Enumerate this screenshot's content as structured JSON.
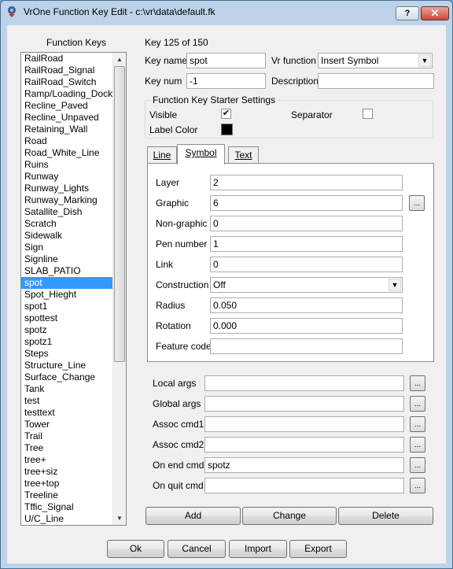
{
  "window": {
    "title": "VrOne Function Key Edit - c:\\vr\\data\\default.fk",
    "help_label": "?",
    "close_label": "✕"
  },
  "left": {
    "header": "Function Keys",
    "items": [
      "RailRoad",
      "RailRoad_Signal",
      "RailRoad_Switch",
      "Ramp/Loading_Dock",
      "Recline_Paved",
      "Recline_Unpaved",
      "Retaining_Wall",
      "Road",
      "Road_White_Line",
      "Ruins",
      "Runway",
      "Runway_Lights",
      "Runway_Marking",
      "Satallite_Dish",
      "Scratch",
      "Sidewalk",
      "Sign",
      "Signline",
      "SLAB_PATIO",
      "spot",
      "Spot_Hieght",
      "spot1",
      "spottest",
      "spotz",
      "spotz1",
      "Steps",
      "Structure_Line",
      "Surface_Change",
      "Tank",
      "test",
      "testtext",
      "Tower",
      "Trail",
      "Tree",
      "tree+",
      "tree+siz",
      "tree+top",
      "Treeline",
      "Tffic_Signal",
      "U/C_Line"
    ],
    "selected": "spot"
  },
  "header": {
    "key_counter": "Key 125 of 150",
    "key_name_label": "Key name",
    "key_name_value": "spot",
    "vr_function_label": "Vr function",
    "vr_function_value": "Insert Symbol",
    "key_num_label": "Key num",
    "key_num_value": "-1",
    "description_label": "Description",
    "description_value": ""
  },
  "starter": {
    "title": "Function Key Starter Settings",
    "visible_label": "Visible",
    "visible_checked": true,
    "separator_label": "Separator",
    "separator_checked": false,
    "label_color_label": "Label Color",
    "label_color": "#000000"
  },
  "tabs": {
    "line": "Line",
    "symbol": "Symbol",
    "text": "Text",
    "active": "Symbol"
  },
  "symbol": {
    "layer_label": "Layer",
    "layer_value": "2",
    "graphic_label": "Graphic",
    "graphic_value": "6",
    "nongraphic_label": "Non-graphic",
    "nongraphic_value": "0",
    "pen_label": "Pen number",
    "pen_value": "1",
    "link_label": "Link",
    "link_value": "0",
    "construction_label": "Construction",
    "construction_value": "Off",
    "radius_label": "Radius",
    "radius_value": "0.050",
    "rotation_label": "Rotation",
    "rotation_value": "0.000",
    "feature_label": "Feature code",
    "feature_value": ""
  },
  "args": {
    "dots_label": "...",
    "local_label": "Local args",
    "local_value": "",
    "global_label": "Global args",
    "global_value": "",
    "cmd1_label": "Assoc cmd1",
    "cmd1_value": "",
    "cmd2_label": "Assoc cmd2",
    "cmd2_value": "",
    "end_label": "On end cmd",
    "end_value": "spotz",
    "quit_label": "On quit cmd",
    "quit_value": ""
  },
  "actions": {
    "add": "Add",
    "change": "Change",
    "delete": "Delete"
  },
  "footer": {
    "ok": "Ok",
    "cancel": "Cancel",
    "import": "Import",
    "export": "Export"
  }
}
